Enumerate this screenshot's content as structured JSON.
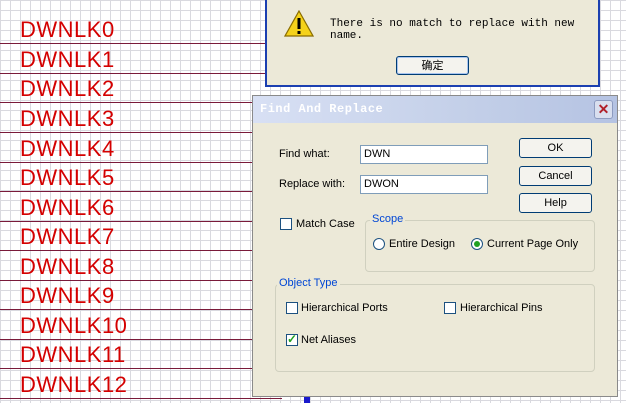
{
  "schematic": {
    "net_labels": [
      "DWNLK0",
      "DWNLK1",
      "DWNLK2",
      "DWNLK3",
      "DWNLK4",
      "DWNLK5",
      "DWNLK6",
      "DWNLK7",
      "DWNLK8",
      "DWNLK9",
      "DWNLK10",
      "DWNLK11",
      "DWNLK12"
    ],
    "label_color": "#d40000",
    "bus_color": "#1a1acc"
  },
  "message_box": {
    "icon": "warning-icon",
    "text": "There is no match to replace with new name.",
    "ok_label": "确定"
  },
  "dialog": {
    "title": "Find And Replace",
    "close_icon": "close-icon",
    "find_what_label": "Find what:",
    "find_what_value": "DWN",
    "replace_with_label": "Replace with:",
    "replace_with_value": "DWON",
    "ok_label": "OK",
    "cancel_label": "Cancel",
    "help_label": "Help",
    "match_case_label": "Match Case",
    "match_case_checked": false,
    "scope": {
      "legend": "Scope",
      "options": [
        {
          "label": "Entire Design",
          "selected": false
        },
        {
          "label": "Current Page Only",
          "selected": true
        }
      ]
    },
    "object_type": {
      "legend": "Object Type",
      "options": [
        {
          "label": "Hierarchical Ports",
          "checked": false
        },
        {
          "label": "Hierarchical Pins",
          "checked": false
        },
        {
          "label": "Net Aliases",
          "checked": true
        }
      ]
    }
  }
}
